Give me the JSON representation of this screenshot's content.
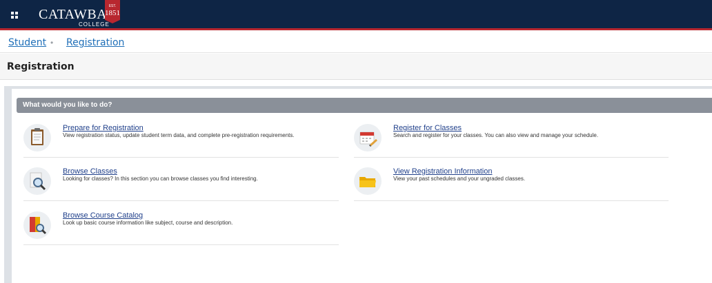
{
  "header": {
    "brand_name": "CATAWBA",
    "brand_sub": "COLLEGE",
    "seal_est": "EST.",
    "seal_year": "1851"
  },
  "breadcrumb": {
    "items": [
      "Student",
      "Registration"
    ],
    "separator": "•"
  },
  "page": {
    "title": "Registration"
  },
  "panel": {
    "heading": "What would you like to do?",
    "actions": [
      {
        "title": "Prepare for Registration",
        "description": "View registration status, update student term data, and complete pre-registration requirements.",
        "icon": "clipboard-icon"
      },
      {
        "title": "Register for Classes",
        "description": "Search and register for your classes. You can also view and manage your schedule.",
        "icon": "calendar-pencil-icon"
      },
      {
        "title": "Browse Classes",
        "description": "Looking for classes? In this section you can browse classes you find interesting.",
        "icon": "magnifier-document-icon"
      },
      {
        "title": "View Registration Information",
        "description": "View your past schedules and your ungraded classes.",
        "icon": "folder-icon"
      },
      {
        "title": "Browse Course Catalog",
        "description": "Look up basic course information like subject, course and description.",
        "icon": "catalog-book-icon"
      }
    ]
  },
  "colors": {
    "header_bg": "#0e2545",
    "accent_red": "#b8272f",
    "link_blue": "#1f6fb8",
    "panel_header_bg": "#8a9099"
  }
}
